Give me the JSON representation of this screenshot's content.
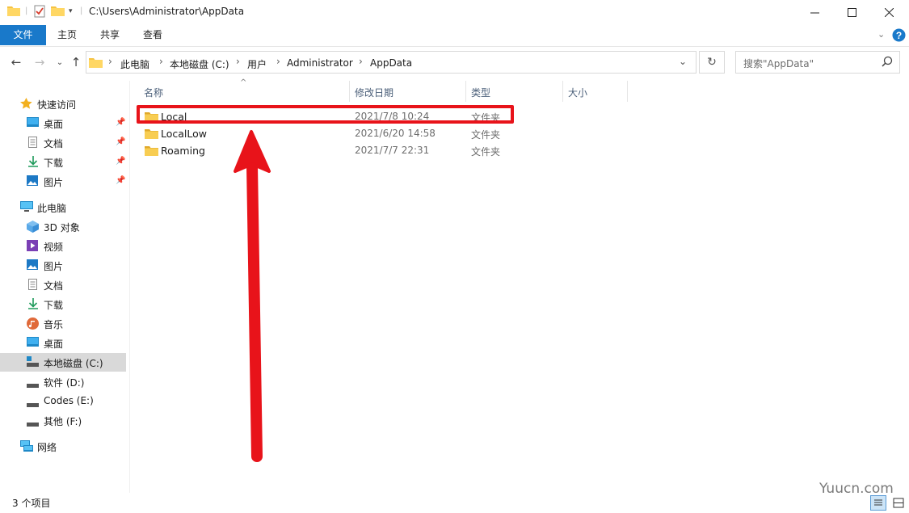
{
  "titlebar": {
    "path": "C:\\Users\\Administrator\\AppData",
    "minimize_icon": "minimize-icon",
    "maximize_icon": "maximize-icon",
    "close_icon": "close-icon"
  },
  "ribbon": {
    "tabs": [
      "文件",
      "主页",
      "共享",
      "查看"
    ],
    "help_icon": "help-icon"
  },
  "address": {
    "crumbs": [
      "此电脑",
      "本地磁盘 (C:)",
      "用户",
      "Administrator",
      "AppData"
    ]
  },
  "search": {
    "placeholder": "搜索\"AppData\""
  },
  "sidebar": {
    "quick_access": "快速访问",
    "quick_items": [
      {
        "label": "桌面",
        "icon": "desktop-icon"
      },
      {
        "label": "文档",
        "icon": "document-icon"
      },
      {
        "label": "下载",
        "icon": "download-icon"
      },
      {
        "label": "图片",
        "icon": "picture-icon"
      }
    ],
    "this_pc": "此电脑",
    "pc_items": [
      {
        "label": "3D 对象",
        "icon": "3d-objects-icon"
      },
      {
        "label": "视频",
        "icon": "video-icon"
      },
      {
        "label": "图片",
        "icon": "picture-icon"
      },
      {
        "label": "文档",
        "icon": "document-icon"
      },
      {
        "label": "下载",
        "icon": "download-icon"
      },
      {
        "label": "音乐",
        "icon": "music-icon"
      },
      {
        "label": "桌面",
        "icon": "desktop-icon"
      },
      {
        "label": "本地磁盘 (C:)",
        "icon": "drive-icon"
      },
      {
        "label": "软件 (D:)",
        "icon": "drive-icon"
      },
      {
        "label": "Codes (E:)",
        "icon": "drive-icon"
      },
      {
        "label": "其他 (F:)",
        "icon": "drive-icon"
      }
    ],
    "network": "网络"
  },
  "columns": {
    "name": "名称",
    "date": "修改日期",
    "type": "类型",
    "size": "大小"
  },
  "files": [
    {
      "name": "Local",
      "date": "2021/7/8 10:24",
      "type": "文件夹"
    },
    {
      "name": "LocalLow",
      "date": "2021/6/20 14:58",
      "type": "文件夹"
    },
    {
      "name": "Roaming",
      "date": "2021/7/7 22:31",
      "type": "文件夹"
    }
  ],
  "status": {
    "count": "3 个项目"
  },
  "watermark": "Yuucn.com",
  "colors": {
    "accent": "#1979ca",
    "highlight": "#e8131a",
    "folder": "#f5c343"
  }
}
